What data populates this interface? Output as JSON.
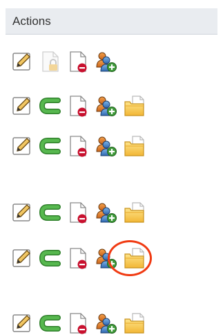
{
  "header": {
    "title": "Actions"
  },
  "rows": [
    {
      "icons": [
        "pencil-edit-icon",
        "page-locked-icon",
        "page-delete-icon",
        "users-add-icon"
      ]
    },
    {
      "icons": [
        "pencil-edit-icon",
        "green-redo-arrow-icon",
        "page-delete-icon",
        "users-add-icon",
        "folder-page-icon"
      ]
    },
    {
      "icons": [
        "pencil-edit-icon",
        "green-redo-arrow-icon",
        "page-delete-icon",
        "users-add-icon",
        "folder-page-icon"
      ]
    },
    {
      "icons": [
        "pencil-edit-icon",
        "green-redo-arrow-icon",
        "page-delete-icon",
        "users-add-icon",
        "folder-page-icon"
      ]
    },
    {
      "icons": [
        "pencil-edit-icon",
        "green-redo-arrow-icon",
        "page-delete-icon",
        "users-add-icon",
        "folder-page-icon"
      ],
      "highlighted": "folder-page-icon"
    },
    {
      "icons": [
        "pencil-edit-icon",
        "green-redo-arrow-icon",
        "page-delete-icon",
        "users-add-icon",
        "folder-page-icon"
      ]
    }
  ],
  "colors": {
    "header_bg": "#e9ecf0",
    "highlight_ring": "#f03a12",
    "arrow_green": "#3f9a3a",
    "delete_red": "#c8102e",
    "folder_yellow": "#f6c244"
  }
}
